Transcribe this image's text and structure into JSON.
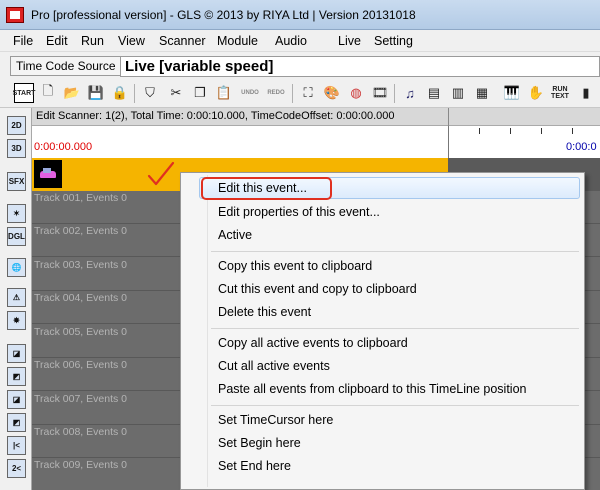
{
  "window": {
    "title": "Pro [professional version] - GLS © 2013 by RIYA Ltd |  Version 20131018"
  },
  "menubar": {
    "items": [
      "File",
      "Edit",
      "Run",
      "View",
      "Scanner",
      "Module",
      "Audio",
      "Live",
      "Setting"
    ]
  },
  "timecode": {
    "label": "Time Code Source",
    "value": "Live [variable speed]"
  },
  "toolbar": {
    "start_label": "START",
    "undo_label": "UNDO",
    "redo_label": "REDO",
    "run_text_label": "RUN TEXT"
  },
  "left_icons": [
    "2D",
    "3D",
    "SFX",
    "",
    "DGL",
    "",
    "",
    "",
    "",
    "",
    "",
    "",
    "|<",
    "2<"
  ],
  "scanner": {
    "info": "Edit Scanner: 1(2), Total Time: 0:00:10.000, TimeCodeOffset: 0:00:00.000",
    "time_left": "0:00:00.000",
    "time_right": "0:00:0"
  },
  "tracks": [
    "Track 001, Events 0",
    "Track 002, Events 0",
    "Track 003, Events 0",
    "Track 004, Events 0",
    "Track 005, Events 0",
    "Track 006, Events 0",
    "Track 007, Events 0",
    "Track 008, Events 0",
    "Track 009, Events 0"
  ],
  "context_menu": {
    "items": [
      "Edit this event...",
      "Edit properties of this event...",
      "Active",
      "Copy this event to clipboard",
      "Cut this event and copy to clipboard",
      "Delete this event",
      "Copy all active events to clipboard",
      "Cut all active events",
      "Paste all events from clipboard to this TimeLine position",
      "Set TimeCursor here",
      "Set Begin here",
      "Set End here"
    ]
  },
  "colors": {
    "event_bar": "#f5b400",
    "timeline_bg": "#6c6c6c",
    "highlight_box": "#e03020",
    "time_left": "#e00000",
    "time_right": "#0000aa"
  }
}
